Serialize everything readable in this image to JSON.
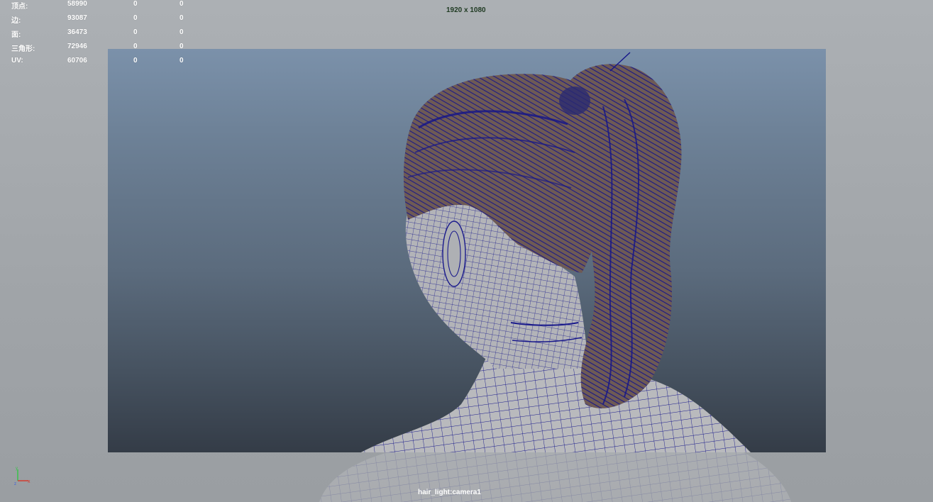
{
  "hud": {
    "rows": [
      {
        "label": "顶点:",
        "c1": "58990",
        "c2": "0",
        "c3": "0"
      },
      {
        "label": "边:",
        "c1": "93087",
        "c2": "0",
        "c3": "0"
      },
      {
        "label": "面:",
        "c1": "36473",
        "c2": "0",
        "c3": "0"
      },
      {
        "label": "三角形:",
        "c1": "72946",
        "c2": "0",
        "c3": "0"
      },
      {
        "label": "UV:",
        "c1": "60706",
        "c2": "0",
        "c3": "0"
      }
    ]
  },
  "resolution_gate": "1920 x 1080",
  "camera_name": "hair_light:camera1",
  "colors": {
    "wireframe": "#1a1a8c",
    "hair_fill": "#6e5a55",
    "skin": "#b9babd",
    "hud_text": "#ffffff",
    "resolution_text": "#1f3a22"
  }
}
